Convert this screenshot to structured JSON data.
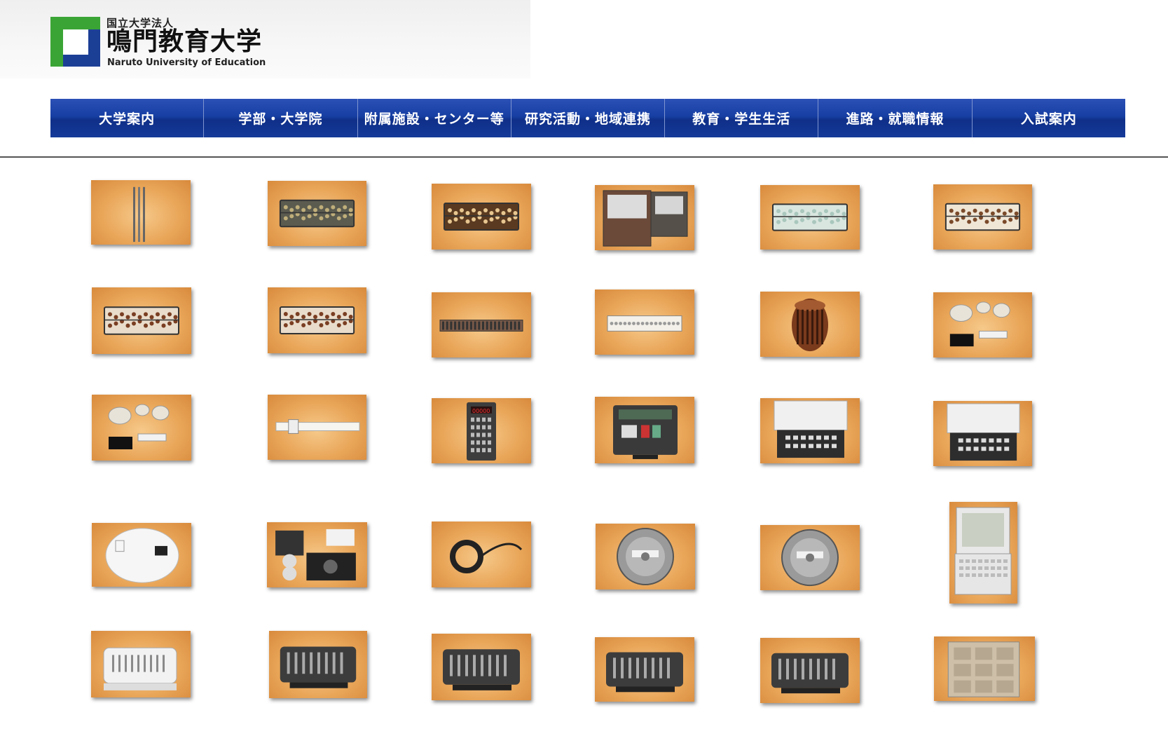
{
  "logo": {
    "org_label": "国立大学法人",
    "name_ja": "鳴門教育大学",
    "name_en": "Naruto University of Education",
    "colors": {
      "green": "#3aa535",
      "blue": "#1c3f96"
    }
  },
  "nav": {
    "items": [
      {
        "label": "大学案内"
      },
      {
        "label": "学部・大学院"
      },
      {
        "label": "附属施設・センター等"
      },
      {
        "label": "研究活動・地域連携"
      },
      {
        "label": "教育・学生生活"
      },
      {
        "label": "進路・就職情報"
      },
      {
        "label": "入試案内"
      }
    ]
  },
  "gallery": {
    "items": [
      {
        "icon": "calculating-rods"
      },
      {
        "icon": "dark-abacus"
      },
      {
        "icon": "wooden-abacus"
      },
      {
        "icon": "cased-abacus-pair"
      },
      {
        "icon": "white-bead-abacus"
      },
      {
        "icon": "white-abacus-small"
      },
      {
        "icon": "long-abacus"
      },
      {
        "icon": "long-abacus-2"
      },
      {
        "icon": "thin-soroban"
      },
      {
        "icon": "white-soroban"
      },
      {
        "icon": "cylindrical-calculator"
      },
      {
        "icon": "abacus-parts"
      },
      {
        "icon": "abacus-parts-set"
      },
      {
        "icon": "slide-rule"
      },
      {
        "icon": "handheld-calculator"
      },
      {
        "icon": "desktop-calculator"
      },
      {
        "icon": "electronic-calculator"
      },
      {
        "icon": "electronic-calculator-2"
      },
      {
        "icon": "disk-pack"
      },
      {
        "icon": "floppy-disks"
      },
      {
        "icon": "magnetic-tape-strip"
      },
      {
        "icon": "tape-reel"
      },
      {
        "icon": "tape-reel-2"
      },
      {
        "icon": "laptop-computer"
      },
      {
        "icon": "mechanical-calculator-white"
      },
      {
        "icon": "mechanical-calculator"
      },
      {
        "icon": "mechanical-calculator-2"
      },
      {
        "icon": "mechanical-calculator-3"
      },
      {
        "icon": "mechanical-calculator-4"
      },
      {
        "icon": "core-memory-board"
      }
    ]
  }
}
